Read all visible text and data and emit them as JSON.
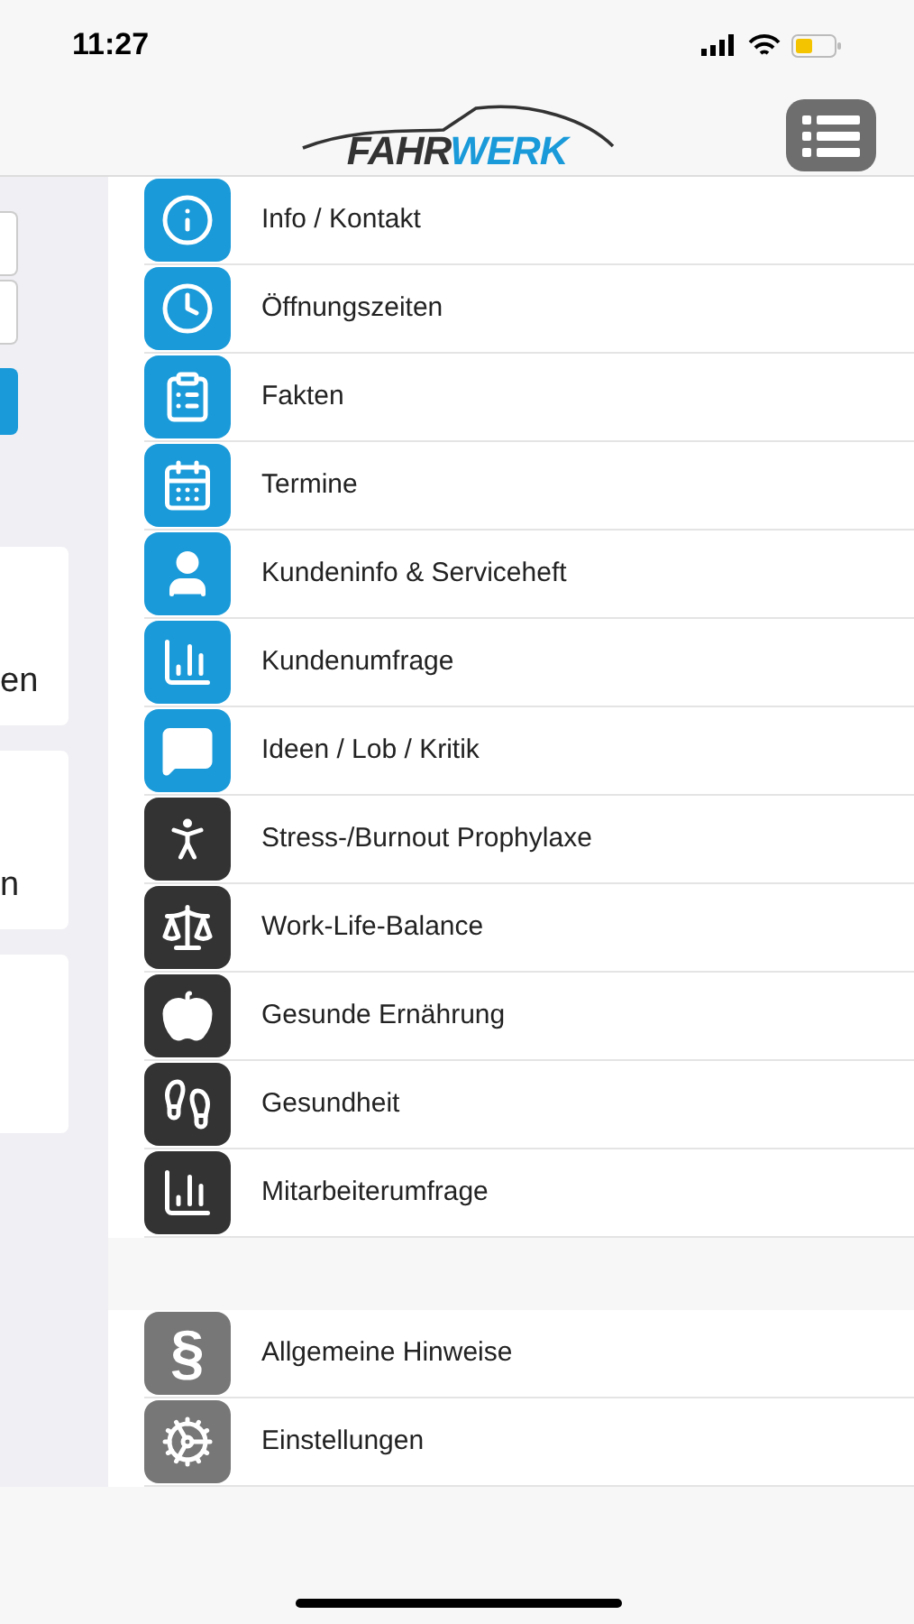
{
  "status_bar": {
    "time": "11:27"
  },
  "header": {
    "logo": {
      "dark": "FAHR",
      "accent": "WERK"
    }
  },
  "background_page": {
    "cards": [
      {
        "kind": "text",
        "text": "en"
      },
      {
        "kind": "text",
        "text": "n"
      },
      {
        "kind": "blank"
      }
    ]
  },
  "menu": {
    "sections": [
      {
        "items": [
          {
            "label": "Info / Kontakt",
            "kind": "info",
            "color": "#1a9ad9"
          },
          {
            "label": "Öffnungszeiten",
            "kind": "clock",
            "color": "#1a9ad9"
          },
          {
            "label": "Fakten",
            "kind": "clipboard",
            "color": "#1a9ad9"
          },
          {
            "label": "Termine",
            "kind": "calendar",
            "color": "#1a9ad9"
          },
          {
            "label": "Kundeninfo & Serviceheft",
            "kind": "user",
            "color": "#1a9ad9"
          },
          {
            "label": "Kundenumfrage",
            "kind": "chart",
            "color": "#1a9ad9"
          },
          {
            "label": "Ideen / Lob / Kritik",
            "kind": "chat",
            "color": "#1a9ad9"
          },
          {
            "label": "Stress-/Burnout Prophylaxe",
            "kind": "meditation",
            "color": "#333333"
          },
          {
            "label": "Work-Life-Balance",
            "kind": "scale",
            "color": "#333333"
          },
          {
            "label": "Gesunde Ernährung",
            "kind": "apple",
            "color": "#333333"
          },
          {
            "label": "Gesundheit",
            "kind": "health",
            "color": "#333333"
          },
          {
            "label": "Mitarbeiterumfrage",
            "kind": "chart",
            "color": "#333333"
          }
        ]
      },
      {
        "items": [
          {
            "label": "Allgemeine Hinweise",
            "kind": "section",
            "glyph": "§",
            "color": "#777777"
          },
          {
            "label": "Einstellungen",
            "kind": "gears",
            "color": "#777777"
          }
        ]
      }
    ]
  }
}
